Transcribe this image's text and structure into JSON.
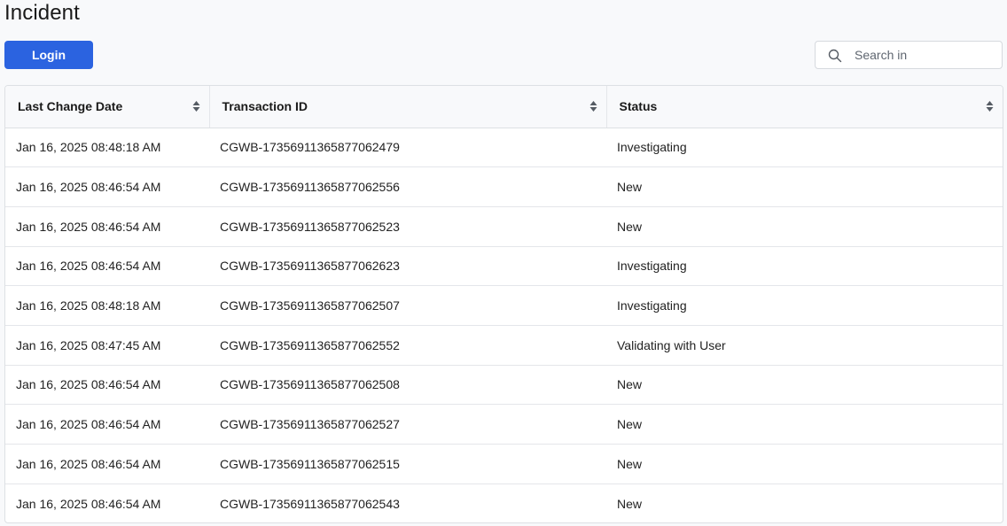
{
  "page": {
    "title": "Incident"
  },
  "toolbar": {
    "login_label": "Login",
    "search_placeholder": "Search in",
    "search_value": ""
  },
  "table": {
    "columns": [
      {
        "label": "Last Change Date",
        "icon": "sort-icon"
      },
      {
        "label": "Transaction ID",
        "icon": "sort-icon"
      },
      {
        "label": "Status",
        "icon": "sort-icon"
      }
    ],
    "rows": [
      {
        "date": "Jan 16, 2025 08:48:18 AM",
        "transaction_id": "CGWB-17356911365877062479",
        "status": "Investigating"
      },
      {
        "date": "Jan 16, 2025 08:46:54 AM",
        "transaction_id": "CGWB-17356911365877062556",
        "status": "New"
      },
      {
        "date": "Jan 16, 2025 08:46:54 AM",
        "transaction_id": "CGWB-17356911365877062523",
        "status": "New"
      },
      {
        "date": "Jan 16, 2025 08:46:54 AM",
        "transaction_id": "CGWB-17356911365877062623",
        "status": "Investigating"
      },
      {
        "date": "Jan 16, 2025 08:48:18 AM",
        "transaction_id": "CGWB-17356911365877062507",
        "status": "Investigating"
      },
      {
        "date": "Jan 16, 2025 08:47:45 AM",
        "transaction_id": "CGWB-17356911365877062552",
        "status": "Validating with User"
      },
      {
        "date": "Jan 16, 2025 08:46:54 AM",
        "transaction_id": "CGWB-17356911365877062508",
        "status": "New"
      },
      {
        "date": "Jan 16, 2025 08:46:54 AM",
        "transaction_id": "CGWB-17356911365877062527",
        "status": "New"
      },
      {
        "date": "Jan 16, 2025 08:46:54 AM",
        "transaction_id": "CGWB-17356911365877062515",
        "status": "New"
      },
      {
        "date": "Jan 16, 2025 08:46:54 AM",
        "transaction_id": "CGWB-17356911365877062543",
        "status": "New"
      }
    ]
  },
  "colors": {
    "accent": "#2b63e0",
    "background": "#f8f9fb",
    "border": "#dde0e4"
  }
}
